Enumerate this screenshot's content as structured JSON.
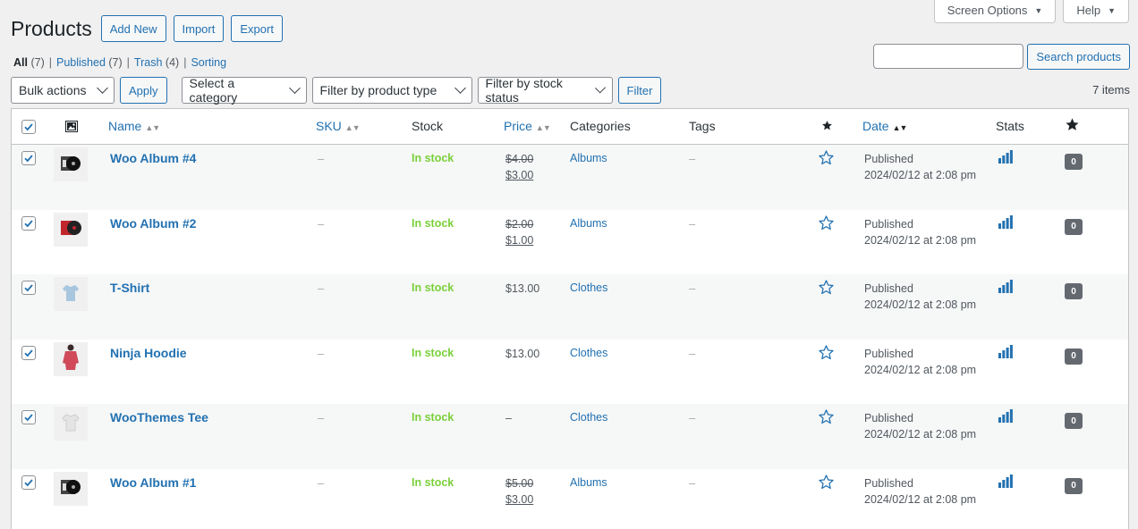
{
  "top_tabs": {
    "screen_options": "Screen Options",
    "help": "Help"
  },
  "header": {
    "title": "Products",
    "add_new": "Add New",
    "import": "Import",
    "export": "Export"
  },
  "views": {
    "all": "All",
    "all_count": "(7)",
    "published": "Published",
    "published_count": "(7)",
    "trash": "Trash",
    "trash_count": "(4)",
    "sorting": "Sorting",
    "separator": "|"
  },
  "search": {
    "button": "Search products",
    "value": ""
  },
  "filters": {
    "bulk_actions": "Bulk actions",
    "apply": "Apply",
    "category": "Select a category",
    "product_type": "Filter by product type",
    "stock_status": "Filter by stock status",
    "filter": "Filter"
  },
  "items_count": "7 items",
  "columns": {
    "name": "Name",
    "sku": "SKU",
    "stock": "Stock",
    "price": "Price",
    "categories": "Categories",
    "tags": "Tags",
    "date": "Date",
    "stats": "Stats"
  },
  "colors": {
    "link": "#2271b1",
    "instock": "#7ad03a",
    "badge": "#646970"
  },
  "rows": [
    {
      "name": "Woo Album #4",
      "sku": "–",
      "stock": "In stock",
      "price_old": "$4.00",
      "price": "$3.00",
      "category": "Albums",
      "tags": "–",
      "status": "Published",
      "date": "2024/02/12 at 2:08 pm",
      "count": "0",
      "thumb": "album-black",
      "checked": true
    },
    {
      "name": "Woo Album #2",
      "sku": "–",
      "stock": "In stock",
      "price_old": "$2.00",
      "price": "$1.00",
      "category": "Albums",
      "tags": "–",
      "status": "Published",
      "date": "2024/02/12 at 2:08 pm",
      "count": "0",
      "thumb": "album-red",
      "checked": true
    },
    {
      "name": "T-Shirt",
      "sku": "–",
      "stock": "In stock",
      "price_old": "",
      "price": "$13.00",
      "category": "Clothes",
      "tags": "–",
      "status": "Published",
      "date": "2024/02/12 at 2:08 pm",
      "count": "0",
      "thumb": "tshirt-blue",
      "checked": true
    },
    {
      "name": "Ninja Hoodie",
      "sku": "–",
      "stock": "In stock",
      "price_old": "",
      "price": "$13.00",
      "category": "Clothes",
      "tags": "–",
      "status": "Published",
      "date": "2024/02/12 at 2:08 pm",
      "count": "0",
      "thumb": "hoodie-red",
      "checked": true
    },
    {
      "name": "WooThemes Tee",
      "sku": "–",
      "stock": "In stock",
      "price_old": "",
      "price": "–",
      "category": "Clothes",
      "tags": "–",
      "status": "Published",
      "date": "2024/02/12 at 2:08 pm",
      "count": "0",
      "thumb": "tshirt-white",
      "checked": true
    },
    {
      "name": "Woo Album #1",
      "sku": "–",
      "stock": "In stock",
      "price_old": "$5.00",
      "price": "$3.00",
      "category": "Albums",
      "tags": "–",
      "status": "Published",
      "date": "2024/02/12 at 2:08 pm",
      "count": "0",
      "thumb": "album-black",
      "checked": true
    }
  ]
}
